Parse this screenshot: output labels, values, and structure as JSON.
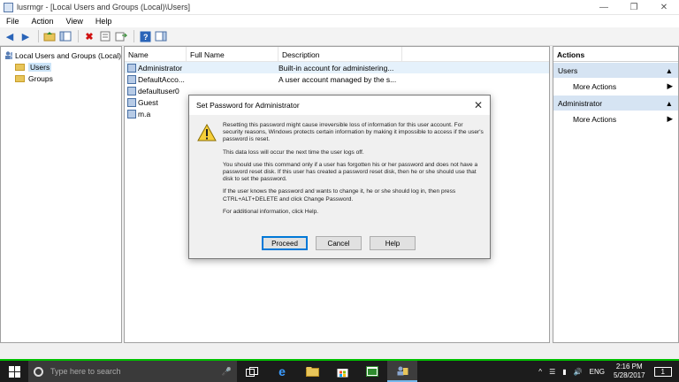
{
  "window": {
    "title": "lusrmgr - [Local Users and Groups (Local)\\Users]",
    "minimize": "—",
    "maximize": "❐",
    "close": "✕"
  },
  "menu": [
    "File",
    "Action",
    "View",
    "Help"
  ],
  "tree": {
    "root": "Local Users and Groups (Local)",
    "children": [
      "Users",
      "Groups"
    ]
  },
  "list": {
    "columns": [
      "Name",
      "Full Name",
      "Description"
    ],
    "rows": [
      {
        "name": "Administrator",
        "full_name": "",
        "description": "Built-in account for administering..."
      },
      {
        "name": "DefaultAcco...",
        "full_name": "",
        "description": "A user account managed by the s..."
      },
      {
        "name": "defaultuser0",
        "full_name": "",
        "description": ""
      },
      {
        "name": "Guest",
        "full_name": "",
        "description": ""
      },
      {
        "name": "m.a",
        "full_name": "",
        "description": ""
      }
    ]
  },
  "actions": {
    "title": "Actions",
    "sections": [
      {
        "label": "Users",
        "item": "More Actions"
      },
      {
        "label": "Administrator",
        "item": "More Actions"
      }
    ]
  },
  "dialog": {
    "title": "Set Password for Administrator",
    "close": "✕",
    "p1": "Resetting this password might cause irreversible loss of information for this user account. For security reasons, Windows protects certain information by making it impossible to access if the user's password is reset.",
    "p2": "This data loss will occur the next time the user logs off.",
    "p3": "You should use this command only if a user has forgotten his or her password and does not have a password reset disk. If this user has created a password reset disk, then he or she should use that disk to set the password.",
    "p4": "If the user knows the password and wants to change it, he or she should log in, then press CTRL+ALT+DELETE and click Change Password.",
    "p5": "For additional information, click Help.",
    "buttons": {
      "proceed": "Proceed",
      "cancel": "Cancel",
      "help": "Help"
    }
  },
  "taskbar": {
    "search_placeholder": "Type here to search",
    "language": "ENG",
    "time": "2:16 PM",
    "date": "5/28/2017",
    "notification_count": "1"
  },
  "colors": {
    "accent": "#0078d7",
    "taskbar": "#1c1c1c",
    "taskbar_border": "#00c000",
    "action_section": "#d6e4f3"
  }
}
